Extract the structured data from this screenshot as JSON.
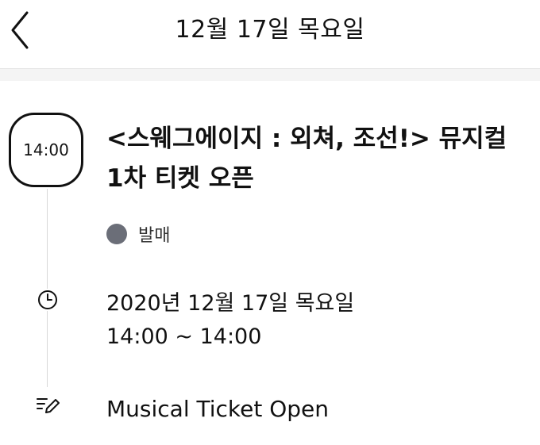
{
  "header": {
    "title": "12월 17일 목요일"
  },
  "event": {
    "time_badge": "14:00",
    "title": "<스웨그에이지 : 외쳐, 조선!> 뮤지컬 1차 티켓 오픈",
    "status": {
      "label": "발매",
      "dot_color": "#6b6e78"
    },
    "date_line": "2020년 12월 17일 목요일",
    "time_range": "14:00 ~ 14:00",
    "description": "Musical Ticket Open"
  },
  "icons": {
    "back": "chevron-left-icon",
    "clock": "clock-icon",
    "memo": "memo-pencil-icon"
  }
}
